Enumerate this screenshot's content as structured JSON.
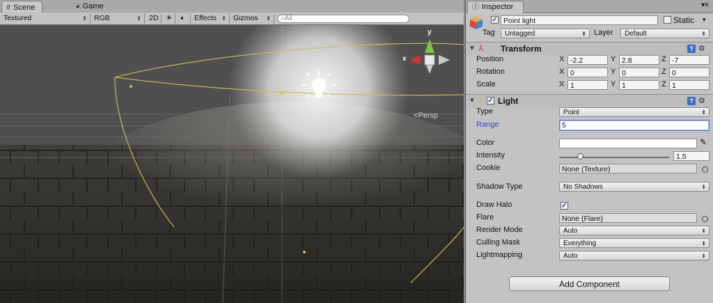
{
  "scene": {
    "tabs": [
      {
        "label": "Scene",
        "icon": "grid-icon"
      },
      {
        "label": "Game",
        "icon": "pacman-icon"
      }
    ],
    "toolbar": {
      "render_mode": "Textured",
      "color_mode": "RGB",
      "mode_2d": "2D",
      "effects": "Effects",
      "gizmos": "Gizmos",
      "search_placeholder": "All"
    },
    "gizmo": {
      "persp_label": "Persp",
      "axis_x": "x",
      "axis_y": "y"
    }
  },
  "inspector": {
    "tab_label": "Inspector",
    "object": {
      "name": "Point light",
      "static_label": "Static",
      "tag_label": "Tag",
      "tag_value": "Untagged",
      "layer_label": "Layer",
      "layer_value": "Default"
    },
    "transform": {
      "title": "Transform",
      "position_label": "Position",
      "rotation_label": "Rotation",
      "scale_label": "Scale",
      "axis_x": "X",
      "axis_y": "Y",
      "axis_z": "Z",
      "position": {
        "x": "-2.2",
        "y": "2.8",
        "z": "-7"
      },
      "rotation": {
        "x": "0",
        "y": "0",
        "z": "0"
      },
      "scale": {
        "x": "1",
        "y": "1",
        "z": "1"
      }
    },
    "light": {
      "title": "Light",
      "type_label": "Type",
      "type_value": "Point",
      "range_label": "Range",
      "range_value": "5",
      "color_label": "Color",
      "color_value": "#ffffff",
      "intensity_label": "Intensity",
      "intensity_value": "1.5",
      "intensity_fraction": 0.19,
      "cookie_label": "Cookie",
      "cookie_value": "None (Texture)",
      "shadow_label": "Shadow Type",
      "shadow_value": "No Shadows",
      "halo_label": "Draw Halo",
      "halo_checked": true,
      "flare_label": "Flare",
      "flare_value": "None (Flare)",
      "render_mode_label": "Render Mode",
      "render_mode_value": "Auto",
      "culling_label": "Culling Mask",
      "culling_value": "Everything",
      "lightmapping_label": "Lightmapping",
      "lightmapping_value": "Auto"
    },
    "add_component": "Add Component"
  }
}
